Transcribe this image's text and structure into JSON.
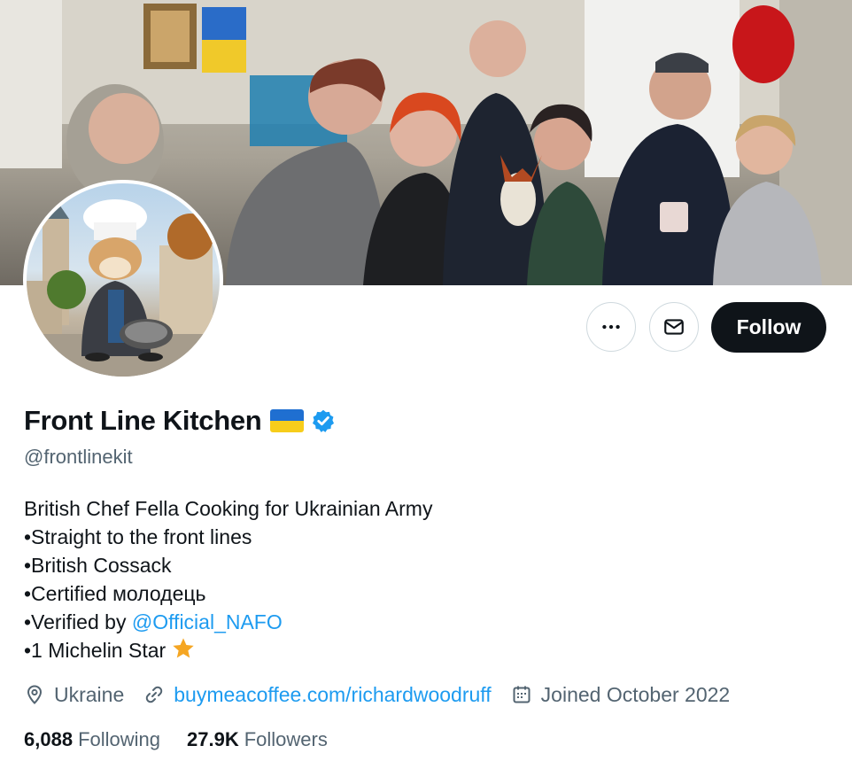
{
  "profile": {
    "display_name": "Front Line Kitchen",
    "handle": "@frontlinekit",
    "flag_icon": "ukraine-flag-icon",
    "verified_icon": "verified-badge-icon",
    "colors": {
      "flag_blue": "#1f6fd1",
      "flag_yellow": "#f7cd1b",
      "verified": "#1d9bf0",
      "accent": "#1d9bf0",
      "text": "#0f1419",
      "muted": "#536471"
    }
  },
  "actions": {
    "more_icon": "more-icon",
    "message_icon": "mail-icon",
    "follow_label": "Follow"
  },
  "bio": {
    "line1": "British Chef Fella Cooking for Ukrainian Army",
    "line2": "•Straight to the front lines",
    "line3": "•British Cossack",
    "line4": "•Certified молодець",
    "line5_prefix": "•Verified by ",
    "line5_mention": "@Official_NAFO",
    "line6": "•1 Michelin Star",
    "star_icon": "star-icon"
  },
  "meta": {
    "location": "Ukraine",
    "website": "buymeacoffee.com/richardwoodruff",
    "joined": "Joined October 2022"
  },
  "stats": {
    "following_count": "6,088",
    "following_label": "Following",
    "followers_count": "27.9K",
    "followers_label": "Followers"
  }
}
